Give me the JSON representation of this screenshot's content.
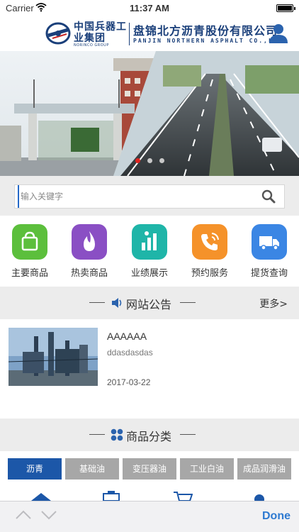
{
  "status_bar": {
    "carrier": "Carrier",
    "time": "11:37 AM",
    "battery_level": 1.0
  },
  "header": {
    "logo_cn_left": "中国兵器工业集团",
    "logo_small": "NORINCO GROUP",
    "logo_cn_right": "盘锦北方沥青股份有限公司",
    "logo_en": "PANJIN NORTHERN ASPHALT CO.,LTD",
    "brand_color": "#1a3f7a"
  },
  "banner": {
    "slide_count": 3,
    "active_slide": 1,
    "active_dot_color": "#e0231e"
  },
  "search": {
    "placeholder": "输入关键字"
  },
  "quicknav": [
    {
      "label": "主要商品",
      "icon": "shopping-bag-icon",
      "color": "#5cbf3c"
    },
    {
      "label": "热卖商品",
      "icon": "flame-icon",
      "color": "#8a4fc4"
    },
    {
      "label": "业绩展示",
      "icon": "bar-chart-icon",
      "color": "#1fb5a8"
    },
    {
      "label": "预约服务",
      "icon": "phone-icon",
      "color": "#f5922a"
    },
    {
      "label": "提货查询",
      "icon": "truck-icon",
      "color": "#3b86e4"
    }
  ],
  "notice": {
    "title": "网站公告",
    "more": "更多>",
    "items": [
      {
        "title": "AAAAAA",
        "subtitle": "ddasdasdas",
        "date": "2017-03-22"
      }
    ]
  },
  "category": {
    "title": "商品分类",
    "tabs": [
      "沥青",
      "基础油",
      "变压器油",
      "工业白油",
      "成品润滑油"
    ],
    "active_tab": 0,
    "active_color": "#1c57a8"
  },
  "accessory": {
    "done_label": "Done"
  }
}
